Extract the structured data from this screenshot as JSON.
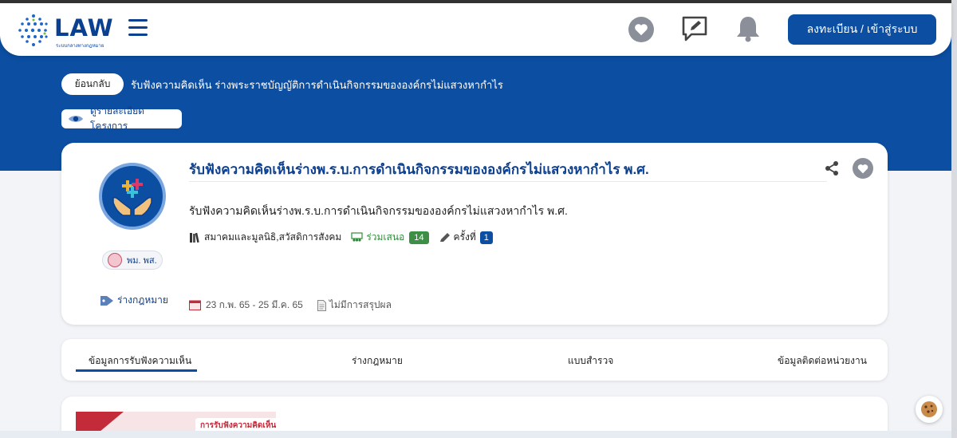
{
  "header": {
    "logo_text": "LAW",
    "logo_subtitle": "ระบบกลางทางกฎหมาย",
    "login_label": "ลงทะเบียน / เข้าสู่ระบบ"
  },
  "breadcrumb": {
    "back_label": "ย้อนกลับ",
    "title": "รับฟังความคิดเห็น ร่างพระราชบัญญัติการดำเนินกิจกรรมขององค์กรไม่แสวงหากำไร",
    "project_details_label": "ดูรายละเอียดโครงการ"
  },
  "project": {
    "title": "รับฟังความคิดเห็นร่างพ.ร.บ.การดำเนินกิจกรรมขององค์กรไม่แสวงหากำไร พ.ศ.",
    "description": "รับฟังความคิดเห็นร่างพ.ร.บ.การดำเนินกิจกรรมขององค์กรไม่แสวงหากำไร พ.ศ.",
    "org_short": "พม. พส.",
    "type_tag": "ร่างกฎหมาย",
    "agency": "สมาคมและมูลนิธิ,สวัสดิการสังคม",
    "participants_label": "ร่วมเสนอ",
    "participants_count": "14",
    "round_label": "ครั้งที่",
    "round_number": "1",
    "date_range": "23 ก.พ. 65 - 25 มี.ค. 65",
    "summary_status": "ไม่มีการสรุปผล"
  },
  "tabs": [
    {
      "label": "ข้อมูลการรับฟังความเห็น"
    },
    {
      "label": "ร่างกฎหมาย"
    },
    {
      "label": "แบบสำรวจ"
    },
    {
      "label": "ข้อมูลติดต่อหน่วยงาน"
    }
  ],
  "content": {
    "banner_label": "การรับฟังความคิดเห็น"
  },
  "colors": {
    "brand_blue": "#0b4ea2",
    "green_badge": "#3c8f44",
    "accent_red": "#c42b3a"
  },
  "icons": [
    "hamburger-menu-icon",
    "heart-icon",
    "comment-edit-icon",
    "bell-icon",
    "eye-icon",
    "share-icon",
    "tag-icon",
    "books-icon",
    "people-icon",
    "pen-icon",
    "calendar-icon",
    "document-icon",
    "cookie-icon"
  ]
}
